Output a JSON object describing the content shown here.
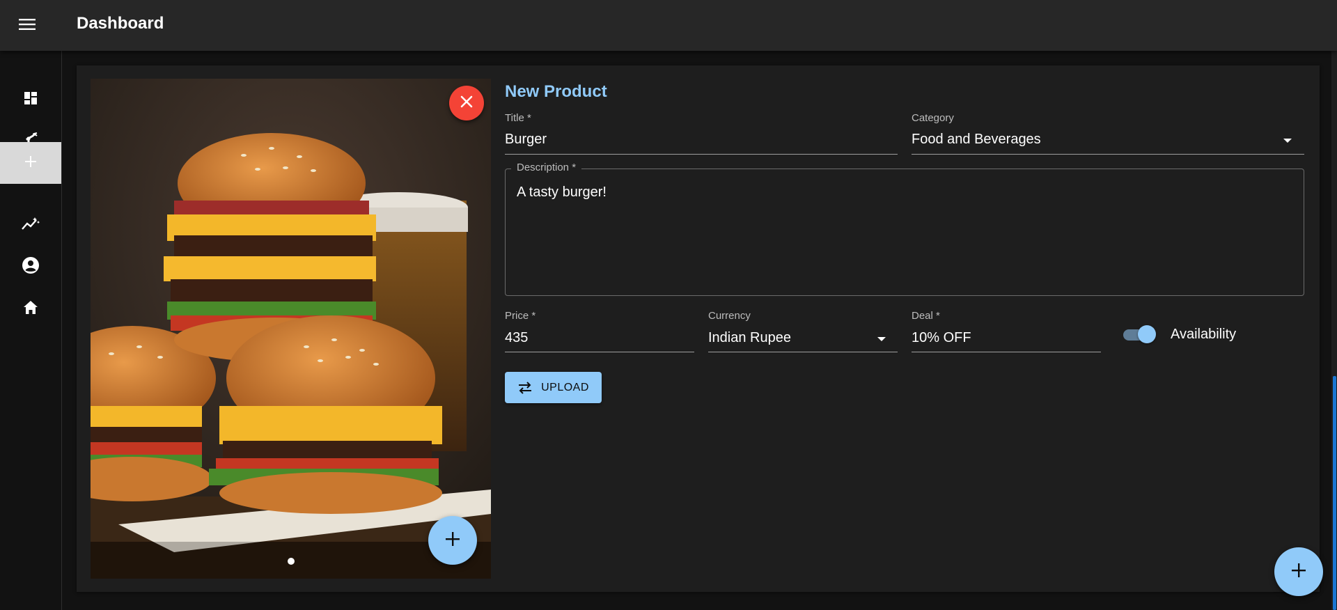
{
  "app": {
    "title": "Dashboard"
  },
  "sidebar": {
    "items": [
      {
        "icon": "dashboard-icon"
      },
      {
        "icon": "robot-arm-icon"
      },
      {
        "icon": "add-icon",
        "active": true
      },
      {
        "icon": "analytics-icon"
      },
      {
        "icon": "account-circle-icon"
      },
      {
        "icon": "home-icon"
      }
    ]
  },
  "image_panel": {
    "image": "burger-photo",
    "carousel_count": 1,
    "carousel_active": 0
  },
  "form": {
    "heading": "New Product",
    "title": {
      "label": "Title *",
      "value": "Burger"
    },
    "category": {
      "label": "Category",
      "value": "Food and Beverages"
    },
    "description": {
      "label": "Description *",
      "value": "A tasty burger!"
    },
    "price": {
      "label": "Price *",
      "value": "435"
    },
    "currency": {
      "label": "Currency",
      "value": "Indian Rupee"
    },
    "deal": {
      "label": "Deal *",
      "value": "10% OFF"
    },
    "availability": {
      "label": "Availability",
      "checked": true
    },
    "upload_label": "UPLOAD"
  },
  "colors": {
    "accent": "#90caf9",
    "danger": "#f44336",
    "surface": "#1e1e1e",
    "appbar": "#272727",
    "background": "#121212"
  }
}
